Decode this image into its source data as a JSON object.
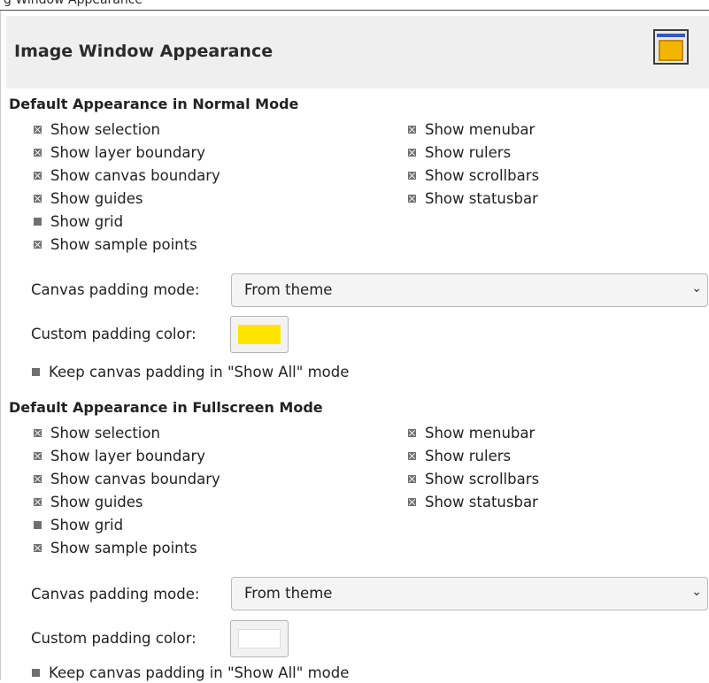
{
  "top_fragment_text": "g Window Appearance",
  "header": {
    "title": "Image Window Appearance",
    "icon": "image-window-icon"
  },
  "normal": {
    "section_title": "Default Appearance in Normal Mode",
    "left_checks": [
      {
        "label": "Show selection",
        "checked": true
      },
      {
        "label": "Show layer boundary",
        "checked": true
      },
      {
        "label": "Show canvas boundary",
        "checked": true
      },
      {
        "label": "Show guides",
        "checked": true
      },
      {
        "label": "Show grid",
        "checked": false
      },
      {
        "label": "Show sample points",
        "checked": true
      }
    ],
    "right_checks": [
      {
        "label": "Show menubar",
        "checked": true
      },
      {
        "label": "Show rulers",
        "checked": true
      },
      {
        "label": "Show scrollbars",
        "checked": true
      },
      {
        "label": "Show statusbar",
        "checked": true
      }
    ],
    "padding_mode_label": "Canvas padding mode:",
    "padding_mode_value": "From theme",
    "padding_color_label": "Custom padding color:",
    "padding_color": "#ffe500",
    "keep_padding_label": "Keep canvas padding in \"Show All\" mode",
    "keep_padding_checked": false
  },
  "fullscreen": {
    "section_title": "Default Appearance in Fullscreen Mode",
    "left_checks": [
      {
        "label": "Show selection",
        "checked": true
      },
      {
        "label": "Show layer boundary",
        "checked": true
      },
      {
        "label": "Show canvas boundary",
        "checked": true
      },
      {
        "label": "Show guides",
        "checked": true
      },
      {
        "label": "Show grid",
        "checked": false
      },
      {
        "label": "Show sample points",
        "checked": true
      }
    ],
    "right_checks": [
      {
        "label": "Show menubar",
        "checked": true
      },
      {
        "label": "Show rulers",
        "checked": true
      },
      {
        "label": "Show scrollbars",
        "checked": true
      },
      {
        "label": "Show statusbar",
        "checked": true
      }
    ],
    "padding_mode_label": "Canvas padding mode:",
    "padding_mode_value": "From theme",
    "padding_color_label": "Custom padding color:",
    "padding_color": "#ffffff",
    "keep_padding_label": "Keep canvas padding in \"Show All\" mode",
    "keep_padding_checked": false
  }
}
